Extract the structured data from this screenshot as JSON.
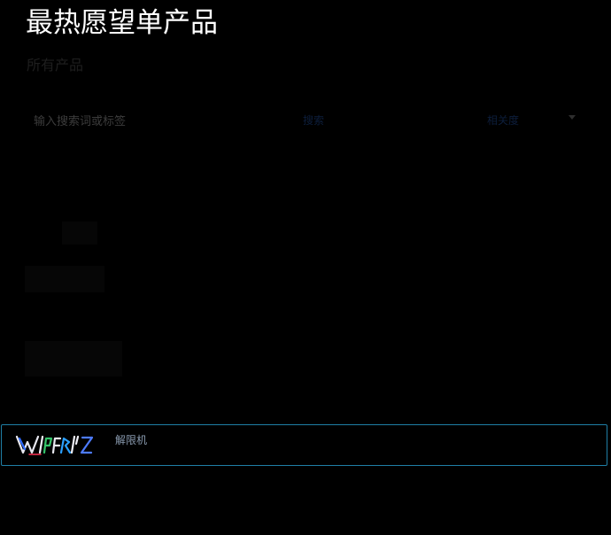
{
  "page": {
    "title": "最热愿望单产品",
    "subtitle": "所有产品"
  },
  "search": {
    "placeholder": "输入搜索词或标签",
    "button_label": "搜索",
    "sort_label": "相关度"
  },
  "products": [
    {
      "name": "解限机",
      "logo_icon": "mecha-break-logo-icon"
    }
  ],
  "colors": {
    "background": "#000000",
    "title": "#ffffff",
    "highlight_border": "#1f7fa6"
  }
}
